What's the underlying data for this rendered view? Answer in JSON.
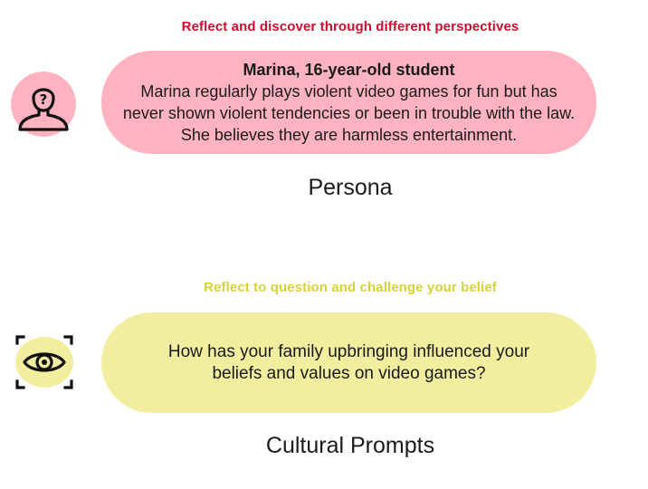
{
  "persona_section": {
    "heading": "Reflect and discover through different perspectives",
    "bubble_title": "Marina, 16-year-old student",
    "bubble_text": "Marina regularly plays violent video games for fun but has never shown violent tendencies or been in trouble with the law. She believes they are harmless entertainment.",
    "caption": "Persona",
    "icon": "person-question-icon",
    "color": "#ffb3c1",
    "heading_color": "#c8102e"
  },
  "cultural_section": {
    "heading": "Reflect to question and challenge your belief",
    "bubble_text": "How has your family upbringing influenced your beliefs and values on video games?",
    "caption": "Cultural Prompts",
    "icon": "eye-focus-icon",
    "color": "#f2ee9f",
    "heading_color": "#d6d239"
  }
}
